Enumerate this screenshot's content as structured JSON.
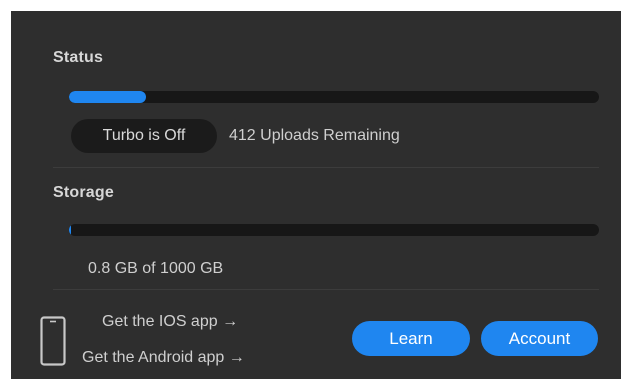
{
  "status": {
    "title": "Status",
    "progress_fraction": 0.146,
    "turbo_label": "Turbo is Off",
    "uploads_remaining": "412 Uploads Remaining"
  },
  "storage": {
    "title": "Storage",
    "progress_fraction": 0.0008,
    "usage_text": "0.8 GB of 1000 GB"
  },
  "apps": {
    "ios_link": "Get the IOS app →",
    "android_link": "Get the Android app →",
    "icon": "smartphone-icon"
  },
  "buttons": {
    "learn": "Learn",
    "account": "Account"
  },
  "colors": {
    "accent": "#1f86f0",
    "panel_bg": "#2e2e2e",
    "track_bg": "#171717"
  }
}
